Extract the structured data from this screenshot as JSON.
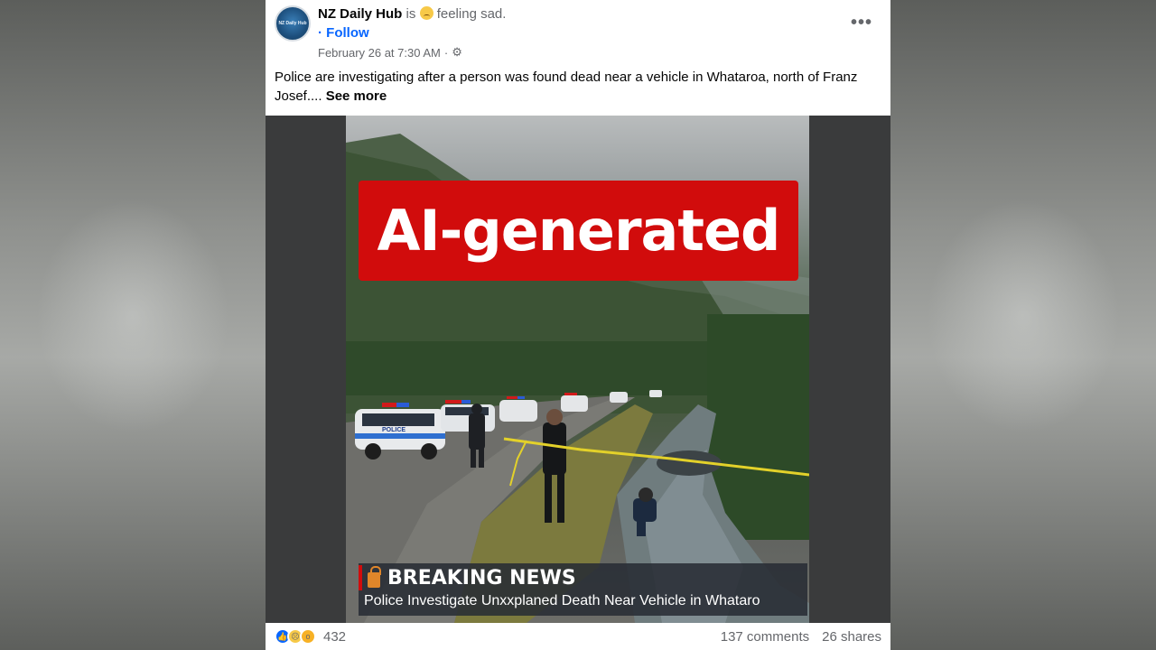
{
  "post": {
    "author": "NZ Daily Hub",
    "is_text": "is",
    "feeling_text": "feeling sad.",
    "follow_label": "· Follow",
    "timestamp": "February 26 at 7:30 AM",
    "timestamp_sep": "·",
    "text": "Police are investigating after a person was found dead near a vehicle in Whataroa, north of Franz Josef....",
    "see_more_label": "See more",
    "avatar_text": "NZ Daily Hub"
  },
  "image": {
    "overlay_label": "AI-generated",
    "breaking_label": "BREAKING NEWS",
    "headline": "Police Investigate Unxxplaned Death Near Vehicle in Whataro",
    "car_label": "POLICE"
  },
  "footer": {
    "reaction_count": "432",
    "comments": "137 comments",
    "shares": "26 shares"
  },
  "colors": {
    "follow": "#0866ff",
    "overlay_red": "#d10c0c",
    "breaking_accent": "#e0862a"
  }
}
